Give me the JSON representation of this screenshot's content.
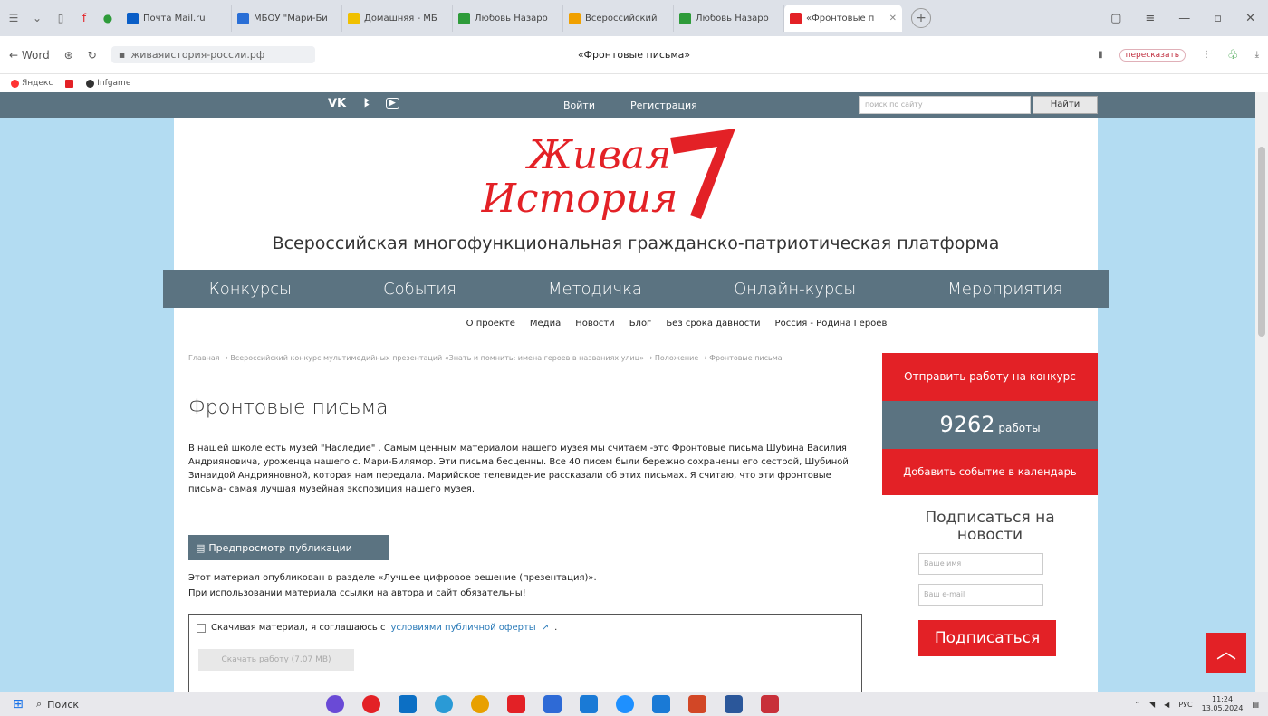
{
  "browser": {
    "tabs": [
      {
        "label": "Почта Mail.ru",
        "color": "#0a5ec7"
      },
      {
        "label": "МБОУ \"Мари-Би",
        "color": "#2a6fd6"
      },
      {
        "label": "Домашняя - МБ",
        "color": "#f0c000"
      },
      {
        "label": "Любовь Назаро",
        "color": "#2e9b3a"
      },
      {
        "label": "Всероссийский",
        "color": "#f0a000"
      },
      {
        "label": "Любовь Назаро",
        "color": "#2e9b3a"
      },
      {
        "label": "«Фронтовые п",
        "color": "#e32126",
        "active": true
      }
    ],
    "back_label": "← Word",
    "url": "живаяистория-россии.рф",
    "title": "«Фронтовые письма»",
    "retell_label": "пересказать",
    "bookmarks": [
      "Яндекс",
      "",
      "Infgame"
    ]
  },
  "site": {
    "top": {
      "vk": "VK",
      "ok": "OK",
      "login": "Войти",
      "register": "Регистрация",
      "search_placeholder": "поиск по сайту",
      "search_button": "Найти"
    },
    "logo": {
      "line1": "Живая",
      "line2": "История"
    },
    "platform": "Всероссийская многофункциональная гражданско-патриотическая платформа",
    "main_menu": [
      "Конкурсы",
      "События",
      "Методичка",
      "Онлайн-курсы",
      "Мероприятия"
    ],
    "sub_menu": [
      "О проекте",
      "Медиа",
      "Новости",
      "Блог",
      "Без срока давности",
      "Россия - Родина Героев"
    ]
  },
  "article": {
    "breadcrumbs": "Главная → Всероссийский конкурс мультимедийных презентаций «Знать и помнить: имена героев в названиях улиц» → Положение → Фронтовые письма",
    "title": "Фронтовые письма",
    "body": "В нашей школе есть музей \"Наследие\" . Самым ценным материалом нашего музея мы считаем -это Фронтовые письма Шубина Василия Андрияновича, уроженца нашего с. Мари-Билямор. Эти письма бесценны. Все 40 писем были бережно сохранены его сестрой, Шубиной Зинаидой Андрияновной, которая нам передала. Марийское телевидение рассказали об этих письмах. Я считаю, что эти фронтовые письма- самая лучшая музейная экспозиция нашего музея.",
    "preview_button": "Предпросмотр публикации",
    "note_line1": "Этот материал опубликован в разделе «Лучшее цифровое решение (презентация)».",
    "note_line2": "При использовании материала ссылки на автора и сайт обязательны!",
    "agree_text": "Скачивая материал, я соглашаюсь с",
    "agree_link": "условиями публичной оферты",
    "download_button": "Скачать работу (7.07 MB)"
  },
  "sidebar": {
    "submit_button": "Отправить работу на конкурс",
    "count": "9262",
    "count_unit": "работы",
    "add_event_button": "Добавить событие в календарь",
    "subscribe_heading": "Подписаться на новости",
    "name_placeholder": "Ваше имя",
    "email_placeholder": "Ваш e-mail",
    "subscribe_button": "Подписаться"
  },
  "taskbar": {
    "search_label": "Поиск",
    "lang": "РУС",
    "time": "11:24",
    "date": "13.05.2024"
  },
  "colors": {
    "accent_red": "#e32126",
    "menu_slate": "#5b7381",
    "page_bg": "#b3dcf2"
  }
}
